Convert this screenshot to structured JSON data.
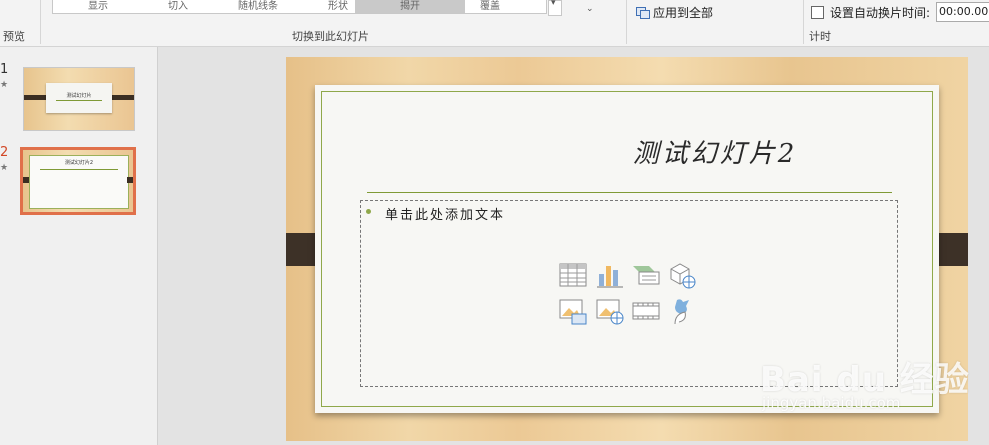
{
  "ribbon": {
    "preview_label": "预览",
    "gallery_items": [
      "显示",
      "切入",
      "随机线条",
      "形状",
      "揭开",
      "覆盖"
    ],
    "gallery_selected": "揭开",
    "transition_group_label": "切换到此幻灯片",
    "apply_all_label": "应用到全部",
    "auto_advance_label": "设置自动换片时间:",
    "auto_advance_time": "00:00.00",
    "timing_group_label": "计时"
  },
  "slides_panel": {
    "slides": [
      {
        "number": "1",
        "star": "★",
        "title": "测试幻灯片"
      },
      {
        "number": "2",
        "star": "★",
        "title": "测试幻灯片2"
      }
    ],
    "selected_index": 1
  },
  "slide": {
    "title": "测试幻灯片2",
    "content_placeholder": "单击此处添加文本"
  },
  "watermark": {
    "brand": "Bai du 经验",
    "url": "jingyan.baidu.com"
  },
  "colors": {
    "accent": "#8fa84a",
    "selection": "#e0704a",
    "tab_dark": "#3d3127"
  },
  "content_icons": [
    "table-icon",
    "chart-icon",
    "smartart-icon",
    "3d-model-icon",
    "picture-icon",
    "online-picture-icon",
    "video-icon",
    "icons-icon"
  ]
}
